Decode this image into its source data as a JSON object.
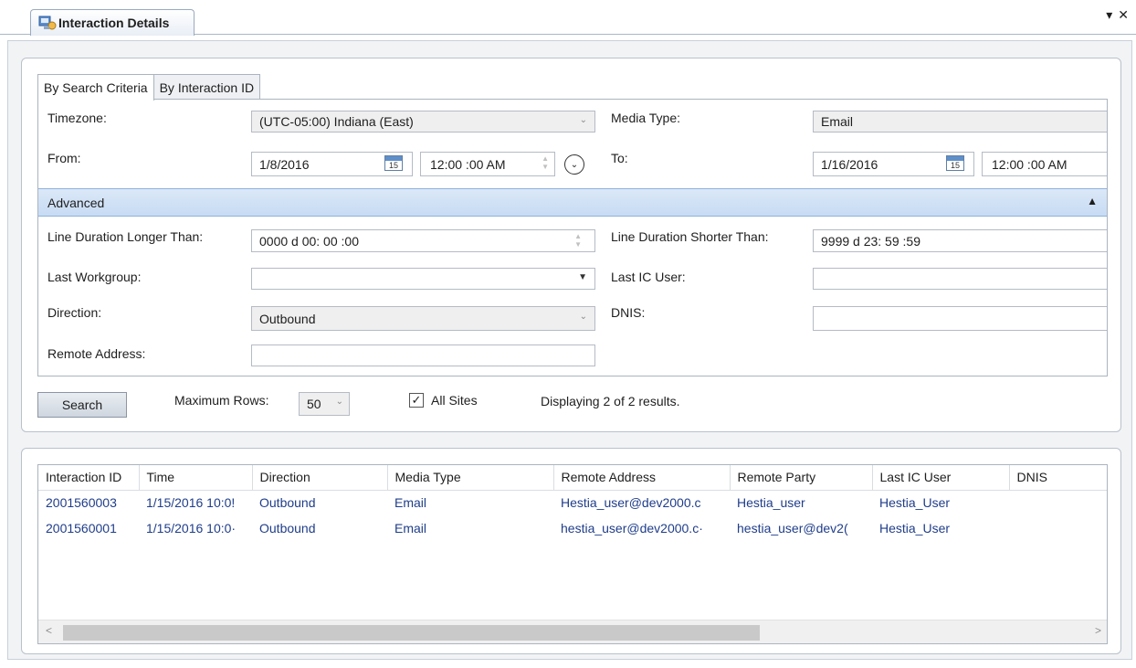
{
  "window": {
    "title": "Interaction Details",
    "pin_glyph": "▾",
    "close_glyph": "✕"
  },
  "tabs": [
    {
      "label": "By Search Criteria",
      "active": true
    },
    {
      "label": "By Interaction ID",
      "active": false
    }
  ],
  "form": {
    "timezone_label": "Timezone:",
    "timezone_value": "(UTC-05:00) Indiana (East)",
    "media_type_label": "Media Type:",
    "media_type_value": "Email",
    "from_label": "From:",
    "from_date": "1/8/2016",
    "from_time": "12:00 :00 AM",
    "to_label": "To:",
    "to_date": "1/16/2016",
    "to_time": "12:00 :00 AM",
    "calendar_day": "15",
    "advanced_label": "Advanced",
    "line_longer_label": "Line Duration Longer Than:",
    "line_longer_value": "0000 d  00: 00 :00",
    "line_shorter_label": "Line Duration Shorter Than:",
    "line_shorter_value": "9999 d  23: 59 :59",
    "last_workgroup_label": "Last Workgroup:",
    "last_workgroup_value": "",
    "last_ic_user_label": "Last IC User:",
    "last_ic_user_value": "",
    "direction_label": "Direction:",
    "direction_value": "Outbound",
    "dnis_label": "DNIS:",
    "dnis_value": "",
    "remote_address_label": "Remote Address:",
    "remote_address_value": ""
  },
  "controls": {
    "search_label": "Search",
    "max_rows_label": "Maximum Rows:",
    "max_rows_value": "50",
    "all_sites_label": "All Sites",
    "all_sites_checked": true,
    "results_text": "Displaying 2 of 2 results."
  },
  "results": {
    "columns": [
      "Interaction ID",
      "Time",
      "Direction",
      "Media Type",
      "Remote Address",
      "Remote Party",
      "Last IC User",
      "DNIS"
    ],
    "rows": [
      [
        "2001560003",
        "1/15/2016 10:0!",
        "Outbound",
        "Email",
        "Hestia_user@dev2000.c",
        "Hestia_user",
        "Hestia_User",
        ""
      ],
      [
        "2001560001",
        "1/15/2016 10:0·",
        "Outbound",
        "Email",
        "hestia_user@dev2000.c·",
        "hestia_user@dev2(",
        "Hestia_User",
        ""
      ]
    ]
  },
  "colors": {
    "accent": "#c7dbf3",
    "link_text": "#1f3d8a"
  },
  "icons": {
    "window_icon": "interaction-details-icon",
    "dropdown": "chevron-down-icon",
    "calendar": "calendar-icon",
    "clock": "clock-icon",
    "collapse": "chevron-up-icon"
  }
}
